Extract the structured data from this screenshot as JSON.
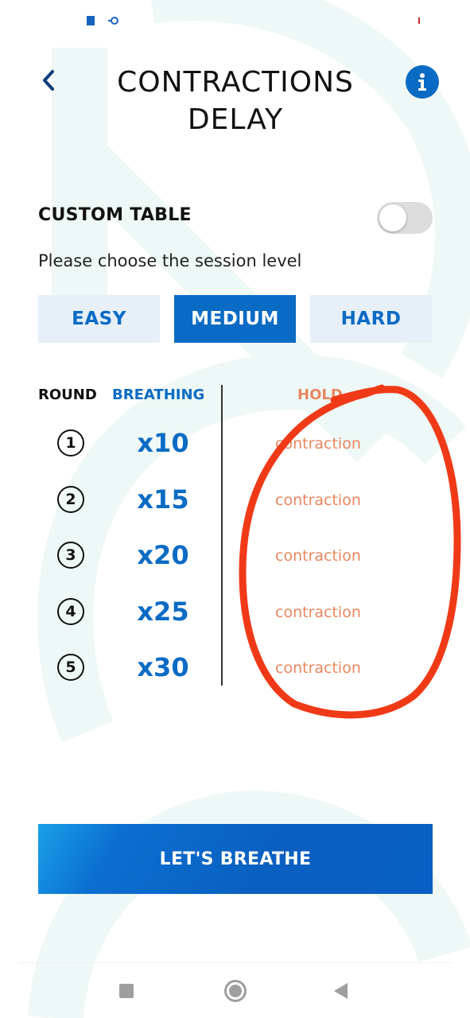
{
  "header": {
    "title_line1": "CONTRACTIONS",
    "title_line2": "DELAY",
    "back_icon": "chevron-left-icon",
    "info_icon": "info-icon",
    "info_label": "i"
  },
  "custom_table": {
    "label": "CUSTOM TABLE",
    "enabled": false
  },
  "session": {
    "prompt": "Please choose the session level",
    "levels": [
      {
        "label": "EASY",
        "selected": false
      },
      {
        "label": "MEDIUM",
        "selected": true
      },
      {
        "label": "HARD",
        "selected": false
      }
    ]
  },
  "table": {
    "headers": {
      "round": "ROUND",
      "breathing": "BREATHING",
      "hold": "HOLD"
    },
    "rows": [
      {
        "round": "1",
        "breathing": "x10",
        "hold": "contraction"
      },
      {
        "round": "2",
        "breathing": "x15",
        "hold": "contraction"
      },
      {
        "round": "3",
        "breathing": "x20",
        "hold": "contraction"
      },
      {
        "round": "4",
        "breathing": "x25",
        "hold": "contraction"
      },
      {
        "round": "5",
        "breathing": "x30",
        "hold": "contraction"
      }
    ]
  },
  "cta": {
    "label": "LET'S BREATHE"
  },
  "colors": {
    "primary": "#0a6bc4",
    "primary_light": "#e7f0f8",
    "hold_accent": "#e8875f",
    "annotation": "#f03a17"
  },
  "nav_bar": {
    "icons": [
      "recents-square-icon",
      "home-circle-icon",
      "back-triangle-icon"
    ]
  }
}
